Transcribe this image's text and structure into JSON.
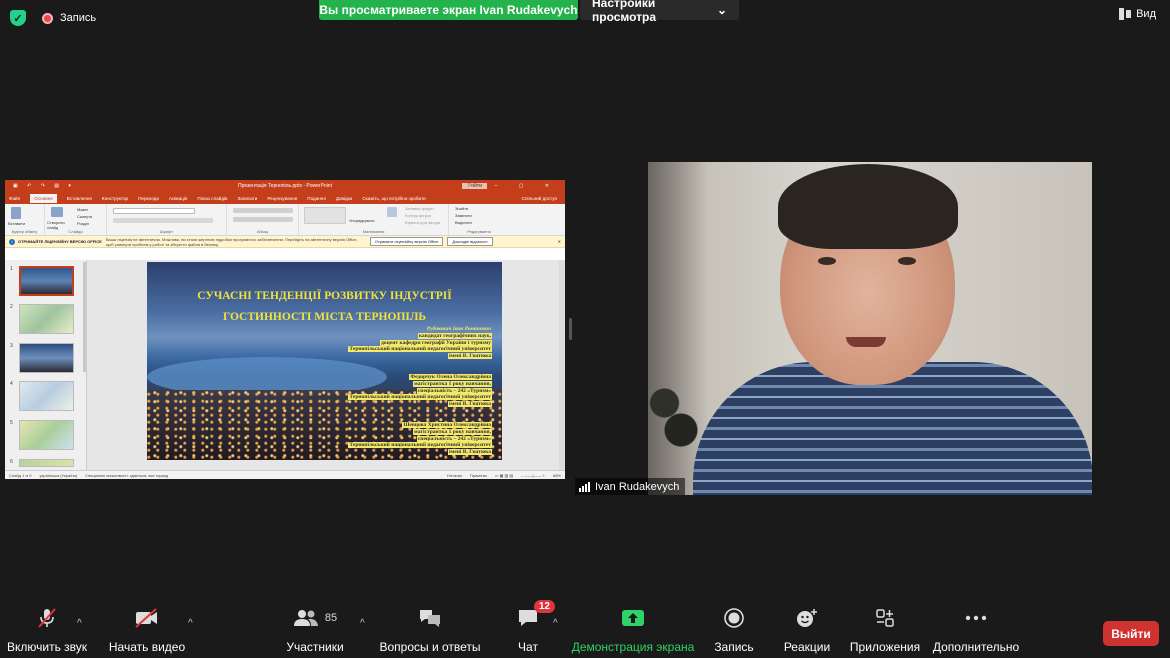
{
  "topbar": {
    "record_label": "Запись",
    "share_banner": "Вы просматриваете экран Ivan Rudakevych",
    "view_settings": "Настройки просмотра",
    "view_button": "Вид"
  },
  "powerpoint": {
    "title": "Презентація Тернопіль.pptx  -  PowerPoint",
    "signin": "Увійти",
    "tabs": [
      "Файл",
      "Основне",
      "Вставлення",
      "Конструктор",
      "Переходи",
      "Анімація",
      "Показ слайдів",
      "Записати",
      "Рецензування",
      "Подання",
      "Довідка",
      "Скажіть, що потрібно зробити",
      "Спільний доступ"
    ],
    "ribbon_groups": [
      "Буфер обміну",
      "Слайди",
      "Шрифт",
      "Абзац",
      "Малювання",
      "Редагування"
    ],
    "ribbon_items": {
      "paste": "Вставити",
      "new_slide": "Створити слайд",
      "layout": "Макет",
      "reset": "Скинути",
      "section": "Розділ",
      "arrange": "Упорядкувати",
      "quick_styles": "Експрес-стилі",
      "fill": "Заливка фігури",
      "outline": "Контур фігури",
      "effects": "Ефекти для фігури",
      "find": "Знайти",
      "replace": "Замінити",
      "select": "Виділити"
    },
    "info_title": "ОТРИМАЙТЕ ЛІЦЕНЗІЙНУ ВЕРСІЮ OFFICE",
    "info_text": "Ваша ліцензія не автентична. Можливо, ви стали жертвою підробки програмного забезпечення. Перейдіть на автентичну версію Office, щоб уникнути проблем у роботі та зберегти файли в безпеці.",
    "info_btn1": "Отримати ліцензійну версію Office",
    "info_btn2": "Докладні відомості",
    "thumb_numbers": [
      "1",
      "2",
      "3",
      "4",
      "5",
      "6"
    ],
    "slide": {
      "title_line1": "СУЧАСНІ ТЕНДЕНЦІЇ РОЗВИТКУ ІНДУСТРІЇ",
      "title_line2": "ГОСТИННОСТІ МІСТА ТЕРНОПІЛЬ",
      "author1": [
        "Рудакевич Іван Романович",
        "кандидат географічних наук,",
        "доцент кафедри географії України і туризму",
        "Тернопільський національний педагогічний університет",
        "імені В. Гнатюка"
      ],
      "author2": [
        "Федорчук Олена Олександрівна",
        "магістрантка 1 року навчання,",
        "спеціальність – 242 «Туризм»",
        "Тернопільський національний педагогічний університет",
        "імені В. Гнатюка"
      ],
      "author3": [
        "Шевцова Христина Олександрівна",
        "магістрантка 1 року навчання,",
        "спеціальність – 242 «Туризм»",
        "Тернопільський національний педагогічний університет",
        "імені В. Гнатюка"
      ]
    },
    "status": {
      "slide": "Слайд 1 із 9",
      "lang": "українська (Україна)",
      "accessibility": "Спеціальні можливості: здається, все гаразд",
      "notes": "Нотатки",
      "comments": "Примітки",
      "zoom": "68%"
    }
  },
  "camera": {
    "participant": "Ivan Rudakevych"
  },
  "toolbar": {
    "unmute": "Включить звук",
    "start_video": "Начать видео",
    "participants": "Участники",
    "participants_count": "85",
    "qa": "Вопросы и ответы",
    "chat": "Чат",
    "chat_badge": "12",
    "share": "Демонстрация экрана",
    "record": "Запись",
    "reactions": "Реакции",
    "apps": "Приложения",
    "more": "Дополнительно",
    "leave": "Выйти"
  },
  "colors": {
    "share_green": "#23b24c",
    "leave_red": "#d0332f",
    "powerpoint_red": "#c43e1c",
    "slide_title_yellow": "#f2e33b"
  }
}
